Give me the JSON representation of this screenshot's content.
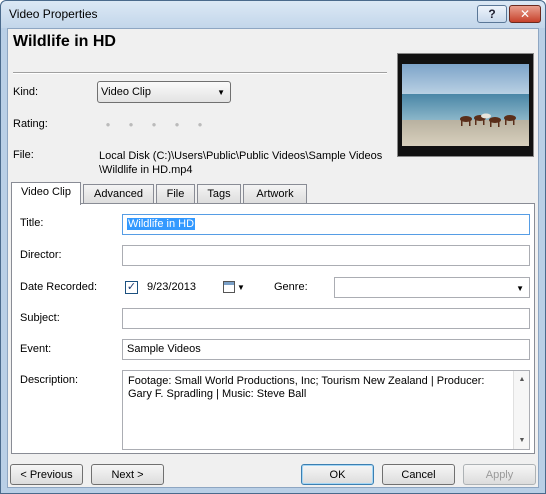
{
  "window": {
    "title": "Video Properties",
    "help_glyph": "?",
    "close_glyph": "✕"
  },
  "header": {
    "heading": "Wildlife in HD"
  },
  "properties": {
    "kind_label": "Kind:",
    "kind_value": "Video Clip",
    "rating_label": "Rating:",
    "rating_value": 0,
    "rating_max": 5,
    "file_label": "File:",
    "file_line1": "Local Disk (C:)\\Users\\Public\\Public Videos\\Sample Videos",
    "file_line2": "\\Wildlife in HD.mp4"
  },
  "tabs": [
    {
      "label": "Video Clip",
      "active": true
    },
    {
      "label": "Advanced",
      "active": false
    },
    {
      "label": "File",
      "active": false
    },
    {
      "label": "Tags",
      "active": false
    },
    {
      "label": "Artwork",
      "active": false
    }
  ],
  "form": {
    "title_label": "Title:",
    "title_value": "Wildlife in HD",
    "director_label": "Director:",
    "director_value": "",
    "date_label": "Date Recorded:",
    "date_checked": true,
    "date_value": "9/23/2013",
    "genre_label": "Genre:",
    "genre_value": "",
    "subject_label": "Subject:",
    "subject_value": "",
    "event_label": "Event:",
    "event_value": "Sample Videos",
    "description_label": "Description:",
    "description_value": "Footage: Small World Productions, Inc; Tourism New Zealand | Producer: Gary F. Spradling | Music: Steve Ball"
  },
  "buttons": {
    "previous": "< Previous",
    "next": "Next >",
    "ok": "OK",
    "cancel": "Cancel",
    "apply": "Apply"
  },
  "icons": {
    "help": "question-mark-icon",
    "close": "close-icon",
    "dropdown": "chevron-down-icon",
    "calendar": "calendar-icon",
    "check": "checkmark-icon"
  }
}
